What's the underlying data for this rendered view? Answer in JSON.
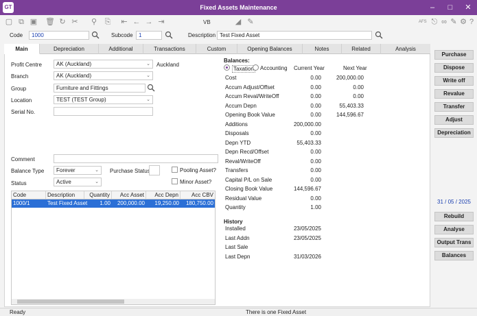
{
  "window": {
    "logo": "GT",
    "title": "Fixed Assets Maintenance"
  },
  "toolbar": {
    "vb": "VB",
    "right_label": "AFS"
  },
  "header": {
    "code_label": "Code",
    "code_value": "1000",
    "subcode_label": "Subcode",
    "subcode_value": "1",
    "description_label": "Description",
    "description_value": "Test Fixed Asset"
  },
  "tabs": [
    "Main",
    "Depreciation",
    "Additional",
    "Transactions",
    "Custom",
    "Opening Balances",
    "Notes",
    "Related",
    "Analysis"
  ],
  "form": {
    "profit_centre_label": "Profit Centre",
    "profit_centre_value": "AK (Auckland)",
    "profit_centre_desc": "Auckland",
    "branch_label": "Branch",
    "branch_value": "AK (Auckland)",
    "group_label": "Group",
    "group_value": "Furniture and Fittings",
    "location_label": "Location",
    "location_value": "TEST (TEST Group)",
    "serial_label": "Serial No.",
    "serial_value": "",
    "comment_label": "Comment",
    "comment_value": "",
    "balance_type_label": "Balance Type",
    "balance_type_value": "Forever",
    "purchase_status_label": "Purchase Status",
    "purchase_status_value": "",
    "pooling_label": "Pooling Asset?",
    "status_label": "Status",
    "status_value": "Active",
    "minor_label": "Minor Asset?"
  },
  "grid": {
    "columns": [
      "Code",
      "Description",
      "Quantity",
      "Acc Asset",
      "Acc Depn",
      "Acc CBV"
    ],
    "rows": [
      [
        "1000/1",
        "Test Fixed Asset",
        "1.00",
        "200,000.00",
        "19,250.00",
        "180,750.00"
      ]
    ]
  },
  "balances": {
    "title": "Balances:",
    "taxation_label": "Taxation",
    "accounting_label": "Accounting",
    "current_year_label": "Current Year",
    "next_year_label": "Next Year",
    "rows": [
      {
        "label": "Cost",
        "mid": "",
        "cur": "0.00",
        "next": "200,000.00"
      },
      {
        "label": "Accum Adjust/Offset",
        "mid": "",
        "cur": "0.00",
        "next": "0.00"
      },
      {
        "label": "Accum Reval/WriteOff",
        "mid": "",
        "cur": "0.00",
        "next": "0.00"
      },
      {
        "label": "Accum Depn",
        "mid": "",
        "cur": "0.00",
        "next": "55,403.33"
      },
      {
        "label": "Opening Book Value",
        "mid": "",
        "cur": "0.00",
        "next": "144,596.67"
      },
      {
        "label": "Additions",
        "mid": "200,000.00",
        "cur": "",
        "next": ""
      },
      {
        "label": "Disposals",
        "mid": "",
        "cur": "0.00",
        "next": ""
      },
      {
        "label": "Depn YTD",
        "mid": "55,403.33",
        "cur": "",
        "next": ""
      },
      {
        "label": "Depn Recd/Offset",
        "mid": "",
        "cur": "0.00",
        "next": ""
      },
      {
        "label": "Reval/WriteOff",
        "mid": "",
        "cur": "0.00",
        "next": ""
      },
      {
        "label": "Transfers",
        "mid": "",
        "cur": "0.00",
        "next": ""
      },
      {
        "label": "Capital P/L on Sale",
        "mid": "",
        "cur": "0.00",
        "next": ""
      },
      {
        "label": "Closing Book Value",
        "mid": "144,596.67",
        "cur": "",
        "next": ""
      },
      {
        "label": "Residual Value",
        "mid": "",
        "cur": "0.00",
        "next": ""
      },
      {
        "label": "Quantity",
        "mid": "",
        "cur": "1.00",
        "next": ""
      }
    ]
  },
  "history": {
    "title": "History",
    "rows": [
      {
        "label": "Installed",
        "value": "23/05/2025"
      },
      {
        "label": "Last Addn",
        "value": "23/05/2025"
      },
      {
        "label": "Last Sale",
        "value": ""
      },
      {
        "label": "Last Depn",
        "value": "31/03/2026"
      }
    ]
  },
  "right_buttons": [
    "Purchase",
    "Dispose",
    "Write off",
    "Revalue",
    "Transfer",
    "Adjust",
    "Depreciation"
  ],
  "date": {
    "day": "31",
    "month": "05",
    "year": "2025"
  },
  "bottom_buttons": [
    "Rebuild",
    "Analyse",
    "Output Trans",
    "Balances"
  ],
  "status": {
    "left": "Ready",
    "center": "There is one Fixed Asset"
  },
  "colors": {
    "titlebar": "#7b3f98",
    "selection": "#2b6fd6"
  }
}
